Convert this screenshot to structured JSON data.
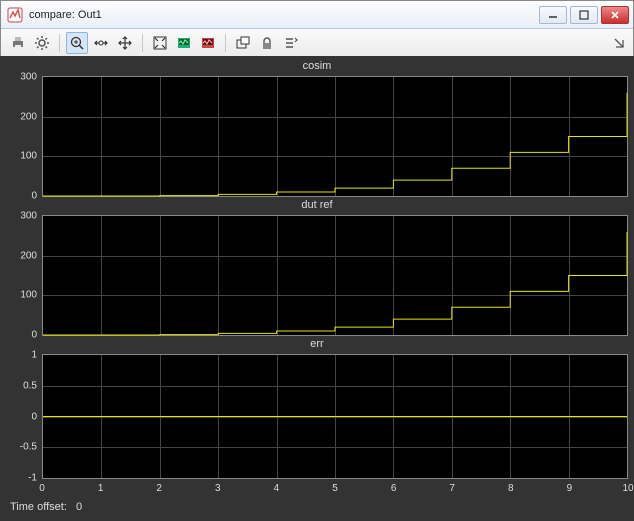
{
  "window": {
    "title": "compare: Out1"
  },
  "toolbar": {
    "icons": [
      "print-icon",
      "gear-icon",
      "|",
      "zoom-in-icon",
      "zoom-x-icon",
      "pan-icon",
      "|",
      "autoscale-icon",
      "scope-params-green-icon",
      "scope-params-red-icon",
      "|",
      "float-icon",
      "lock-icon",
      "signal-select-icon"
    ]
  },
  "time_offset_label": "Time offset:",
  "time_offset_value": "0",
  "chart_data": [
    {
      "type": "line",
      "title": "cosim",
      "step": true,
      "x": [
        0,
        1,
        2,
        3,
        4,
        5,
        6,
        7,
        8,
        9,
        10
      ],
      "y": [
        0,
        0,
        1,
        4,
        10,
        20,
        40,
        70,
        110,
        150,
        200,
        260
      ],
      "xlim": [
        0,
        10
      ],
      "ylim": [
        0,
        300
      ],
      "yticks": [
        0,
        100,
        200,
        300
      ]
    },
    {
      "type": "line",
      "title": "dut ref",
      "step": true,
      "x": [
        0,
        1,
        2,
        3,
        4,
        5,
        6,
        7,
        8,
        9,
        10
      ],
      "y": [
        0,
        0,
        1,
        4,
        10,
        20,
        40,
        70,
        110,
        150,
        200,
        260
      ],
      "xlim": [
        0,
        10
      ],
      "ylim": [
        0,
        300
      ],
      "yticks": [
        0,
        100,
        200,
        300
      ]
    },
    {
      "type": "line",
      "title": "err",
      "step": false,
      "x": [
        0,
        10
      ],
      "y": [
        0,
        0
      ],
      "xlim": [
        0,
        10
      ],
      "ylim": [
        -1,
        1
      ],
      "yticks": [
        -1,
        -0.5,
        0,
        0.5,
        1
      ]
    }
  ],
  "xticks": [
    0,
    1,
    2,
    3,
    4,
    5,
    6,
    7,
    8,
    9,
    10
  ]
}
